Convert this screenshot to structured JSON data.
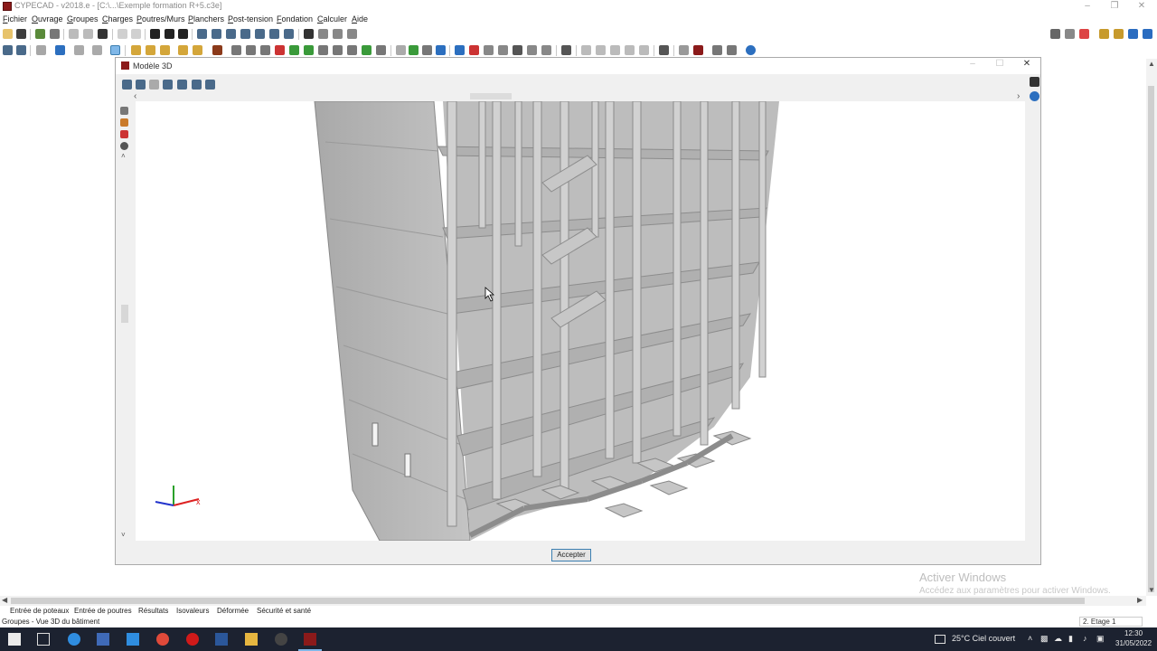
{
  "window": {
    "title": "CYPECAD - v2018.e - [C:\\...\\Exemple formation R+5.c3e]"
  },
  "menu": [
    "Fichier",
    "Ouvrage",
    "Groupes",
    "Charges",
    "Poutres/Murs",
    "Planchers",
    "Post-tension",
    "Fondation",
    "Calculer",
    "Aide"
  ],
  "dialog": {
    "title": "Modèle 3D",
    "accept_label": "Accepter"
  },
  "bottom_tabs": [
    "Entrée de poteaux",
    "Entrée de poutres",
    "Résultats",
    "Isovaleurs",
    "Déformée",
    "Sécurité et santé"
  ],
  "status": {
    "text": "Groupes - Vue 3D du bâtiment",
    "level": "2. Etage 1"
  },
  "watermark": {
    "line1": "Activer Windows",
    "line2": "Accédez aux paramètres pour activer Windows."
  },
  "taskbar": {
    "weather": "25°C  Ciel couvert",
    "time": "12:30",
    "date": "31/05/2022"
  },
  "axes": {
    "x": "x"
  },
  "colors": {
    "accent": "#3c7fb1",
    "brand": "#8b1a1a",
    "taskbar": "#1c2230"
  }
}
